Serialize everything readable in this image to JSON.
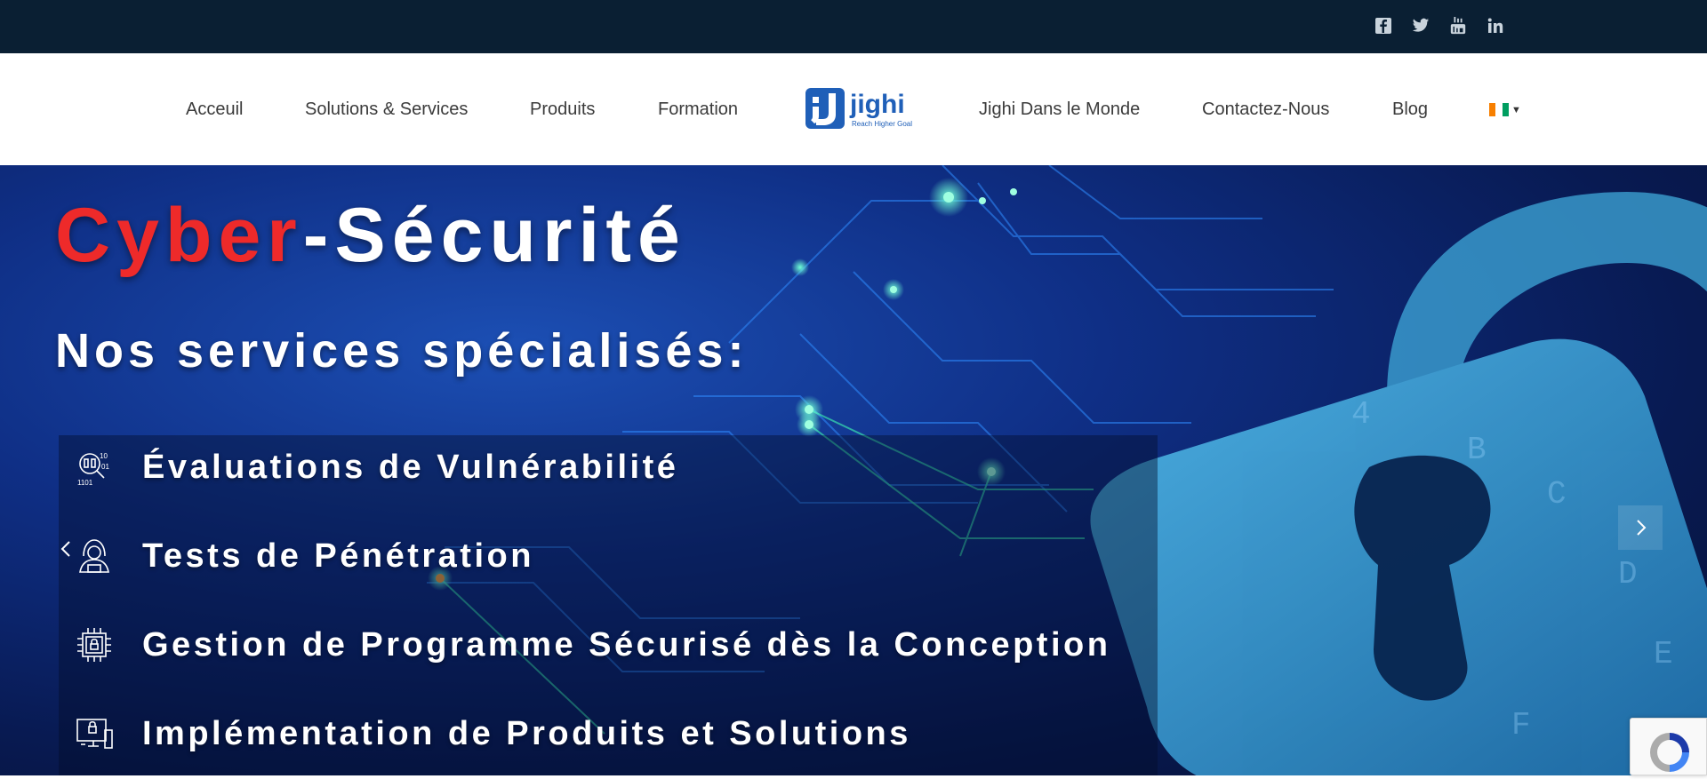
{
  "social": {
    "icons": [
      "facebook-icon",
      "twitter-icon",
      "youtube-icon",
      "linkedin-icon"
    ]
  },
  "nav": {
    "left": [
      "Acceuil",
      "Solutions & Services",
      "Produits",
      "Formation"
    ],
    "right": [
      "Jighi Dans le Monde",
      "Contactez-Nous",
      "Blog"
    ],
    "logo_text": "jighi",
    "logo_tagline": "Reach Higher Goals"
  },
  "hero": {
    "title_red": "Cyber",
    "title_white": "-Sécurité",
    "subtitle": "Nos services spécialisés:",
    "services": [
      "Évaluations de Vulnérabilité",
      "Tests de Pénétration",
      "Gestion de Programme Sécurisé dès la Conception",
      "Implémentation de Produits et Solutions"
    ]
  },
  "colors": {
    "topbar": "#0a1f33",
    "accent_red": "#ee2a2a",
    "logo_blue": "#1f5fb8"
  }
}
